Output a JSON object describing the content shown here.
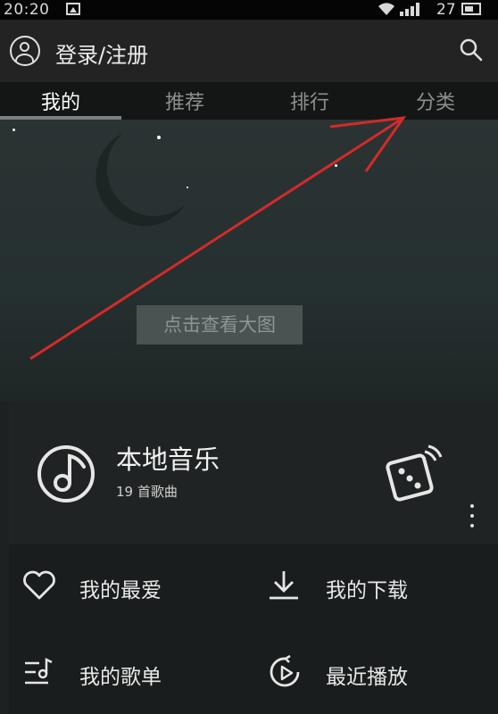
{
  "status_bar": {
    "time": "20:20",
    "battery": "27"
  },
  "header": {
    "login_label": "登录/注册"
  },
  "tabs": [
    {
      "label": "我的",
      "active": true
    },
    {
      "label": "推荐",
      "active": false
    },
    {
      "label": "排行",
      "active": false
    },
    {
      "label": "分类",
      "active": false
    }
  ],
  "banner": {
    "view_image_label": "点击查看大图"
  },
  "local_music": {
    "title": "本地音乐",
    "count": "19 首歌曲"
  },
  "entries": {
    "favorites": "我的最爱",
    "downloads": "我的下载",
    "playlists": "我的歌单",
    "recent": "最近播放"
  },
  "colors": {
    "annotation_arrow": "#d42a2a",
    "background": "#1c2121"
  }
}
